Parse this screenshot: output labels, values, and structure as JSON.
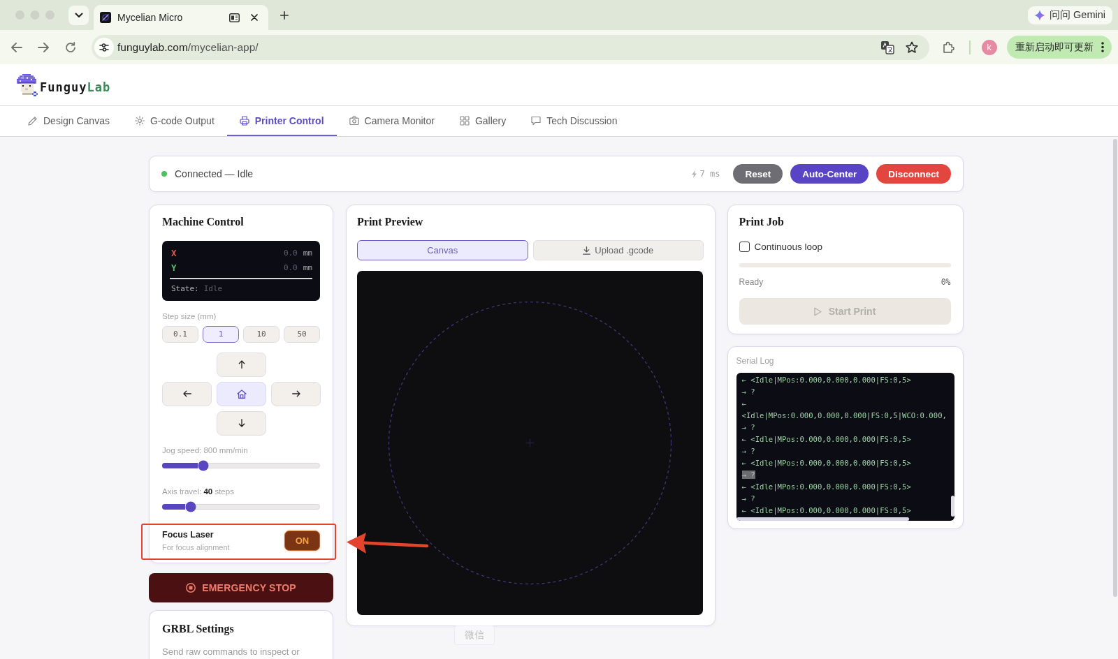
{
  "browser": {
    "tab": {
      "title": "Mycelian Micro"
    },
    "url": {
      "host": "funguylab.com",
      "path": "/mycelian-app/"
    },
    "gemini_button": "问问 Gemini",
    "profile_initial": "k",
    "update_button": "重新启动即可更新"
  },
  "logo": {
    "text": "Funguy",
    "accent": "Lab"
  },
  "nav_tabs": [
    {
      "label": "Design Canvas",
      "selected": false
    },
    {
      "label": "G-code Output",
      "selected": false
    },
    {
      "label": "Printer Control",
      "selected": true
    },
    {
      "label": "Camera Monitor",
      "selected": false
    },
    {
      "label": "Gallery",
      "selected": false
    },
    {
      "label": "Tech Discussion",
      "selected": false
    }
  ],
  "status_bar": {
    "connected": true,
    "status": "Connected — Idle",
    "latency": "7 ms",
    "buttons": [
      {
        "label": "Reset",
        "kind": "neutral"
      },
      {
        "label": "Auto-Center",
        "kind": "primary"
      },
      {
        "label": "Disconnect",
        "kind": "danger"
      }
    ]
  },
  "machine_control": {
    "title": "Machine Control",
    "position_display": {
      "axes": [
        {
          "label": "X",
          "value": "0.0",
          "unit": "mm",
          "color": "#e0574f"
        },
        {
          "label": "Y",
          "value": "0.0",
          "unit": "mm",
          "color": "#5bbf6e"
        }
      ],
      "state_label": "State:",
      "state_value": "Idle"
    },
    "step_size": {
      "label": "Step size (mm)",
      "options": [
        {
          "label": "0.1",
          "selected": false
        },
        {
          "label": "1",
          "selected": true
        },
        {
          "label": "10",
          "selected": false
        },
        {
          "label": "50",
          "selected": false
        }
      ]
    },
    "jog_buttons": [
      {
        "kind": "up"
      },
      {
        "kind": "left"
      },
      {
        "kind": "home"
      },
      {
        "kind": "right"
      },
      {
        "kind": "down"
      }
    ],
    "sliders": [
      {
        "label": "Jog speed: 800 mm/min",
        "level": 0.26
      },
      {
        "label": "Axis travel: **40** steps",
        "level": 0.18
      }
    ],
    "focus_laser": {
      "title": "Focus Laser",
      "subtitle": "For focus alignment",
      "toggle": {
        "label": "ON",
        "on": true
      },
      "annotated": true
    }
  },
  "emergency_stop": {
    "label": "EMERGENCY STOP"
  },
  "grbl_settings": {
    "title": "GRBL Settings",
    "description": "Send raw commands to inspect or"
  },
  "print_preview": {
    "title": "Print Preview",
    "tabs": [
      {
        "label": "Canvas",
        "kind": "canvas",
        "selected": true
      },
      {
        "label": "Upload .gcode",
        "kind": "upload",
        "selected": false
      }
    ]
  },
  "print_job": {
    "title": "Print Job",
    "loop": {
      "label": "Continuous loop",
      "checked": false
    },
    "status": "Ready",
    "percent": "0%",
    "start_button": {
      "label": "Start Print",
      "disabled": true
    }
  },
  "serial_log": {
    "label": "Serial Log",
    "lines": [
      {
        "text": "← <Idle|MPos:0.000,0.000,0.000|FS:0,5>",
        "selected": false
      },
      {
        "text": "→ ?",
        "selected": false
      },
      {
        "text": "←",
        "selected": false
      },
      {
        "text": "<Idle|MPos:0.000,0.000,0.000|FS:0,5|WCO:0.000,",
        "selected": false
      },
      {
        "text": "→ ?",
        "selected": false
      },
      {
        "text": "← <Idle|MPos:0.000,0.000,0.000|FS:0,5>",
        "selected": false
      },
      {
        "text": "→ ?",
        "selected": false
      },
      {
        "text": "← <Idle|MPos:0.000,0.000,0.000|FS:0,5>",
        "selected": false
      },
      {
        "text": "→ ?",
        "selected": true
      },
      {
        "text": "← <Idle|MPos:0.000,0.000,0.000|FS:0,5>",
        "selected": false
      },
      {
        "text": "→ ?",
        "selected": false
      },
      {
        "text": "← <Idle|MPos:0.000,0.000,0.000|FS:0,5>",
        "selected": false
      }
    ]
  },
  "tooltip": {
    "text": "微信"
  }
}
